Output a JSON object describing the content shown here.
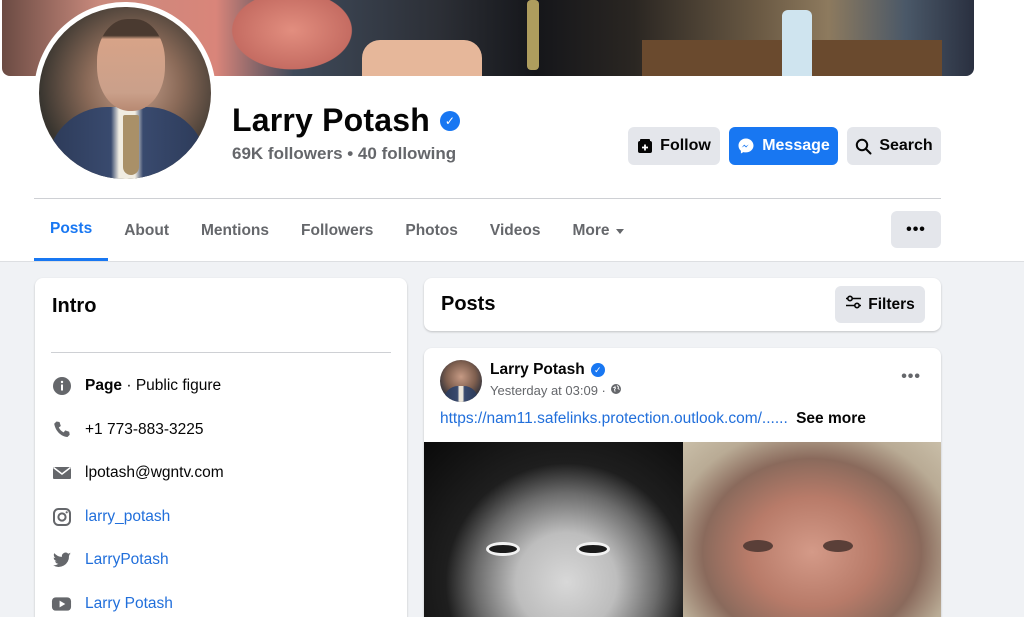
{
  "profile": {
    "name": "Larry Potash",
    "followers_text": "69K followers • 40 following"
  },
  "actions": {
    "follow": "Follow",
    "message": "Message",
    "search": "Search"
  },
  "tabs": [
    {
      "label": "Posts",
      "active": true
    },
    {
      "label": "About"
    },
    {
      "label": "Mentions"
    },
    {
      "label": "Followers"
    },
    {
      "label": "Photos"
    },
    {
      "label": "Videos"
    },
    {
      "label": "More"
    }
  ],
  "tab_more_button": "•••",
  "intro": {
    "title": "Intro",
    "category_label": "Page",
    "category_value": " · Public figure",
    "phone": "+1 773-883-3225",
    "email": "lpotash@wgntv.com",
    "instagram": "larry_potash",
    "twitter": "LarryPotash",
    "youtube": "Larry Potash"
  },
  "posts_section": {
    "title": "Posts",
    "filters": "Filters"
  },
  "post": {
    "author": "Larry Potash",
    "time": "Yesterday at 03:09 ·",
    "more": "•••",
    "url": "https://nam11.safelinks.protection.outlook.com/......",
    "see_more": "See more"
  },
  "colors": {
    "accent": "#1877f2",
    "link": "#216fdb",
    "secondary_text": "#65676b",
    "button_gray": "#e4e6eb",
    "page_bg": "#f0f2f5"
  }
}
